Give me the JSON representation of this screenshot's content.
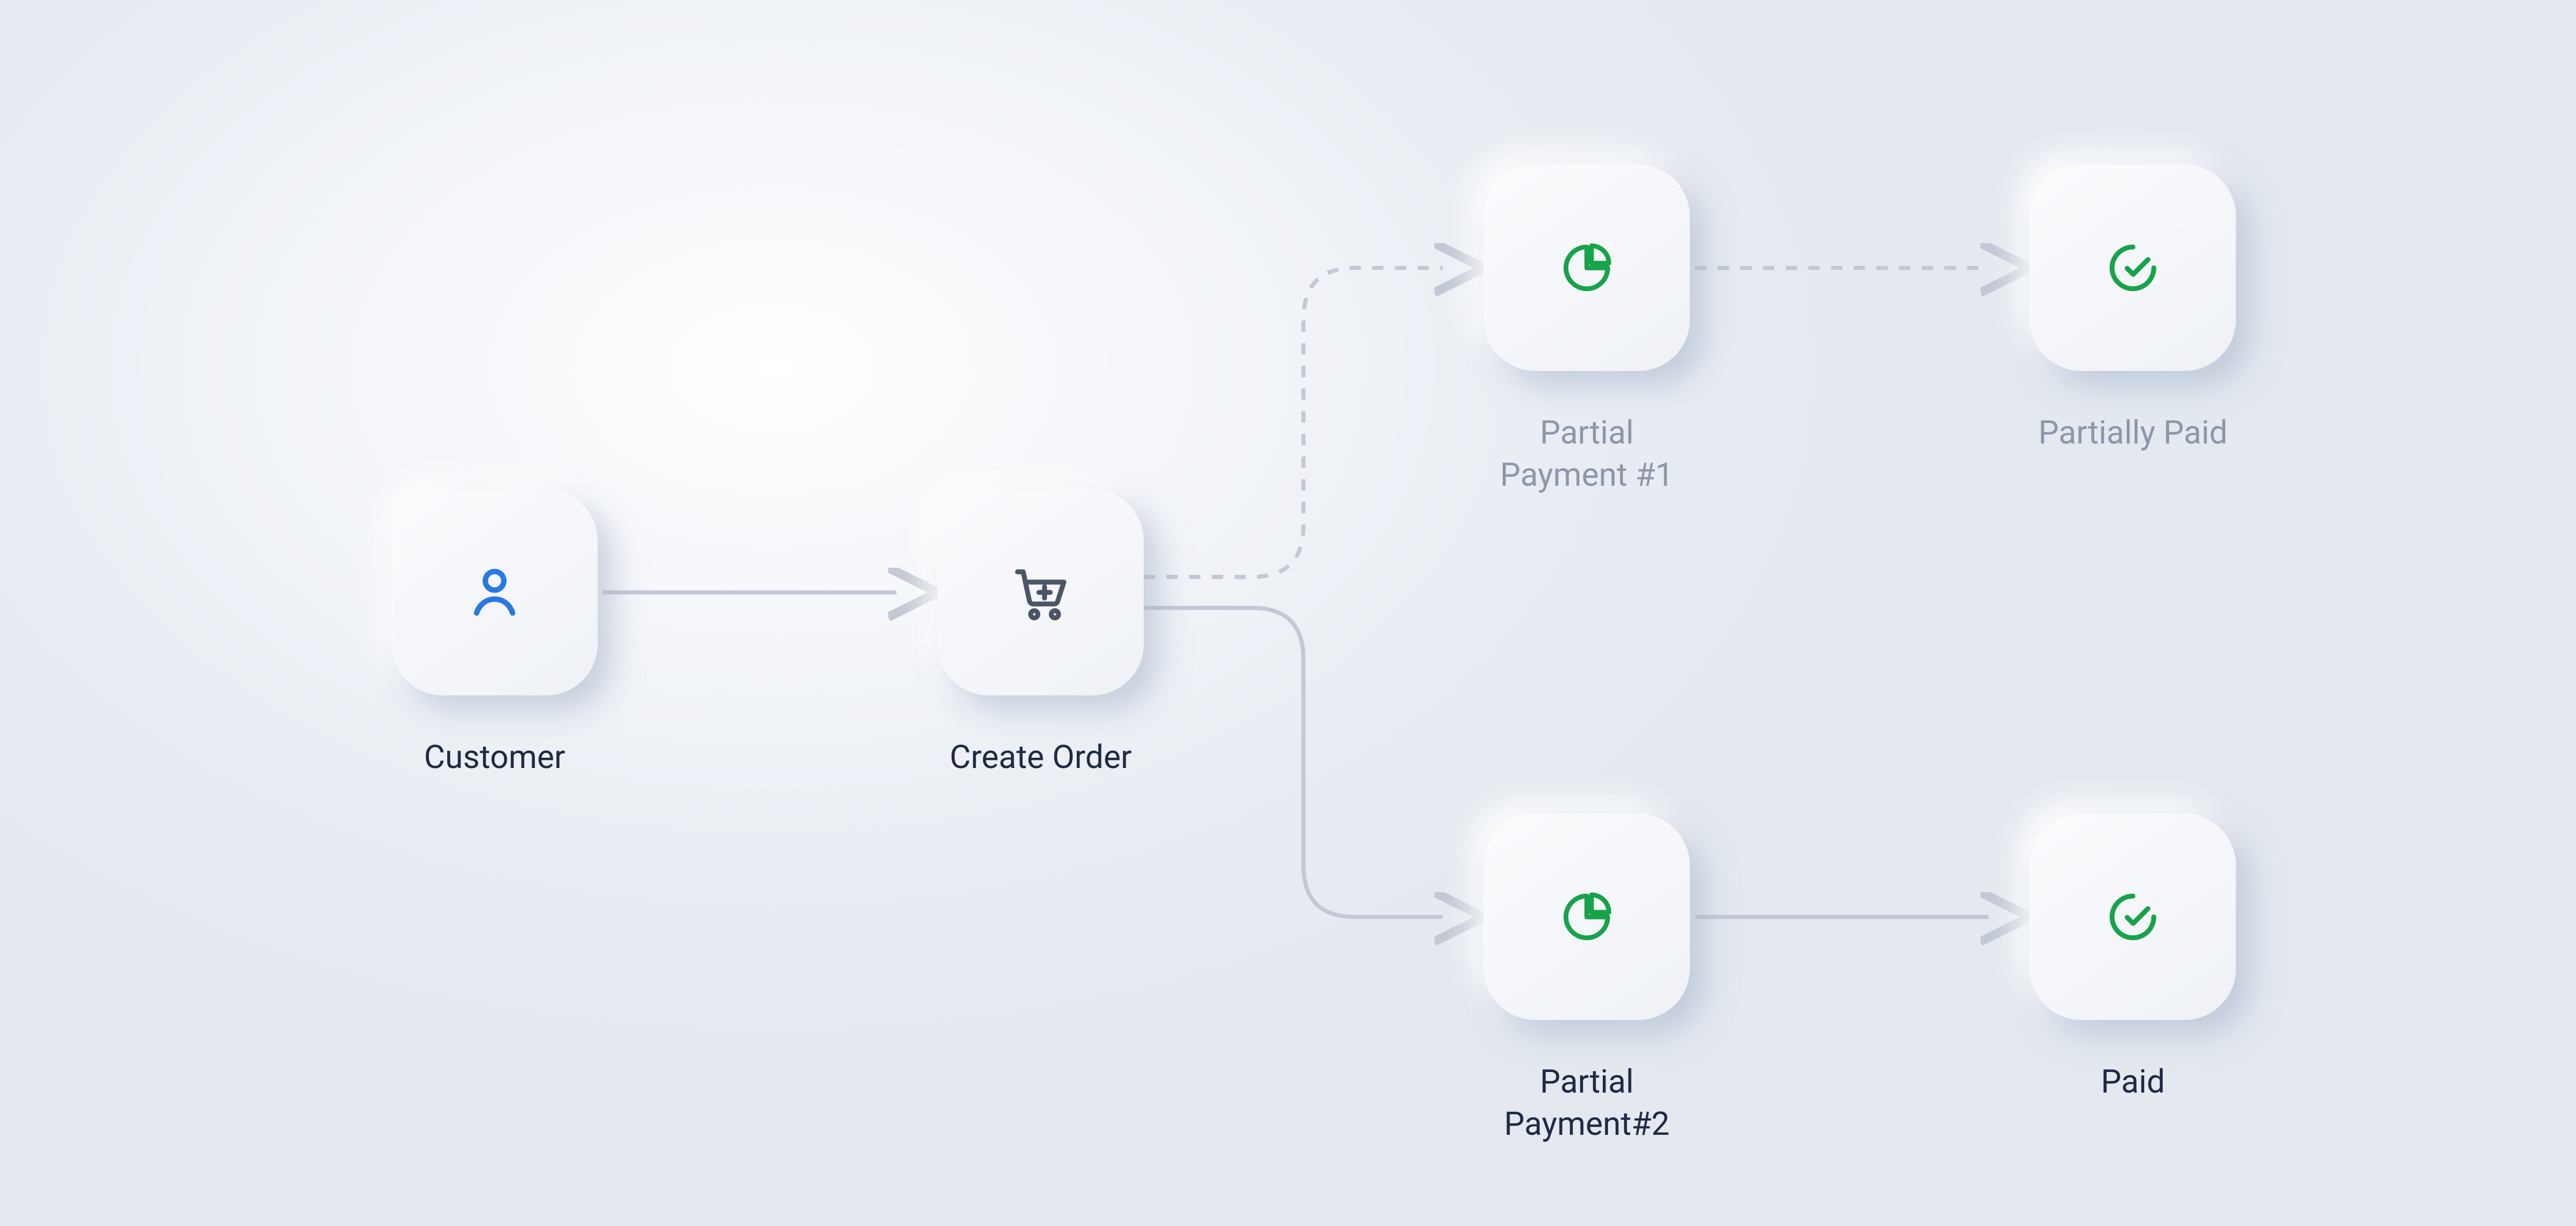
{
  "diagram": {
    "nodes": {
      "customer": {
        "label": "Customer",
        "icon": "user-icon",
        "muted": false
      },
      "create_order": {
        "label": "Create Order",
        "icon": "cart-icon",
        "muted": false
      },
      "partial_pay_1": {
        "label": "Partial\nPayment #1",
        "icon": "pie-icon",
        "muted": true
      },
      "partially_paid": {
        "label": "Partially Paid",
        "icon": "check-icon",
        "muted": true
      },
      "partial_pay_2": {
        "label": "Partial\nPayment#2",
        "icon": "pie-icon",
        "muted": false
      },
      "paid": {
        "label": "Paid",
        "icon": "check-icon",
        "muted": false
      }
    },
    "edges": [
      {
        "from": "customer",
        "to": "create_order",
        "style": "solid"
      },
      {
        "from": "create_order",
        "to": "partial_pay_1",
        "style": "dashed"
      },
      {
        "from": "partial_pay_1",
        "to": "partially_paid",
        "style": "dashed"
      },
      {
        "from": "create_order",
        "to": "partial_pay_2",
        "style": "solid"
      },
      {
        "from": "partial_pay_2",
        "to": "paid",
        "style": "solid"
      }
    ],
    "colors": {
      "line": "#c3c9d4",
      "blue": "#2a78e4",
      "green": "#17a34a",
      "text": "#1f2a44",
      "muted": "#8d97a8"
    }
  }
}
